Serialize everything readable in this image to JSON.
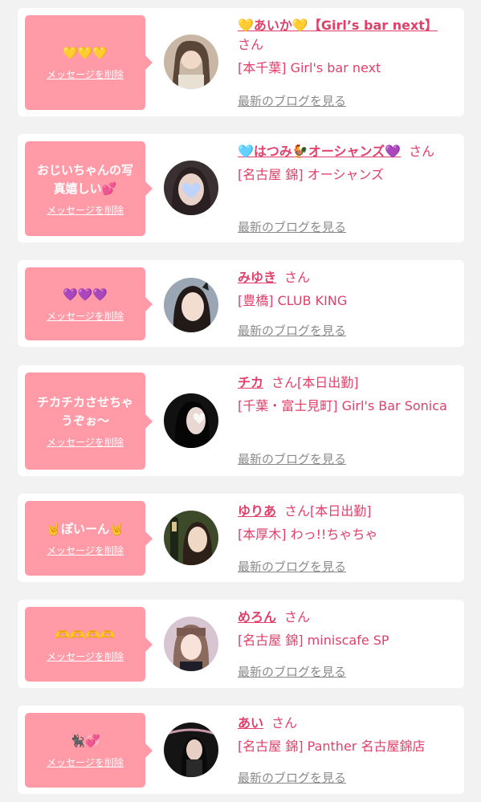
{
  "delete_label": "メッセージを削除",
  "blog_label": "最新のブログを見る",
  "san": "さん",
  "colors": {
    "accent": "#e0406a",
    "bubble": "#ff9aa6",
    "card": "#ffffff",
    "page_bg": "#f2f2f2"
  },
  "cards": [
    {
      "message": "💛💛💛",
      "name": "💛あいか💛【Girl’s bar next】",
      "status": "",
      "shop": "[本千葉] Girl's bar next"
    },
    {
      "message": "おじいちゃんの写真嬉しい💕",
      "name": "🩵はつみ🐓オーシャンズ💜",
      "status": "",
      "shop": "[名古屋 錦] オーシャンズ"
    },
    {
      "message": "💜💜💜",
      "name": "みゆき",
      "status": "",
      "shop": "[豊橋] CLUB KING"
    },
    {
      "message": "チカチカさせちゃうぞぉ〜",
      "name": "チカ",
      "status": "[本日出勤]",
      "shop": "[千葉・富士見町] Girl's Bar Sonica"
    },
    {
      "message": "🤘ぽいーん🤘",
      "name": "ゆりあ",
      "status": "[本日出勤]",
      "shop": "[本厚木] わっ!!ちゃちゃ"
    },
    {
      "message": "🫶🫶🫶🫶",
      "name": "めろん",
      "status": "",
      "shop": "[名古屋 錦] miniscafe SP"
    },
    {
      "message": "🐈‍⬛💞",
      "name": "あい",
      "status": "",
      "shop": "[名古屋 錦] Panther 名古屋錦店"
    }
  ]
}
